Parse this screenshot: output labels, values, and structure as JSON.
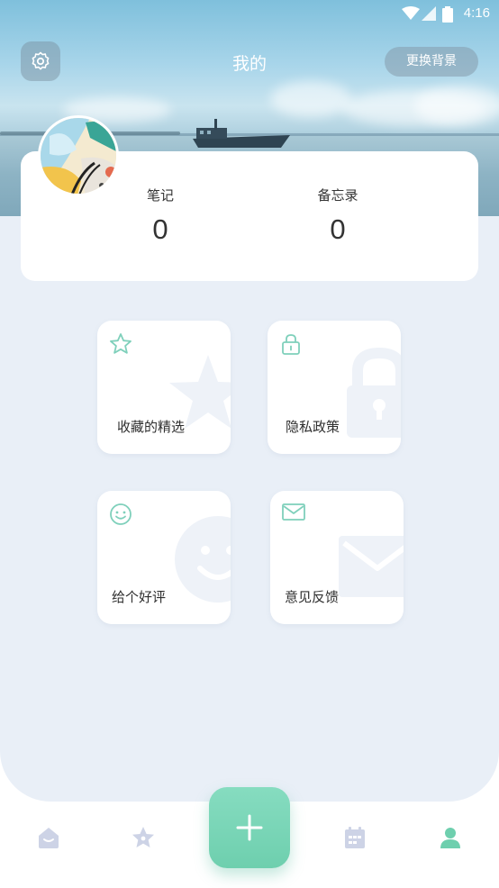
{
  "status_bar": {
    "time": "4:16"
  },
  "header": {
    "title": "我的",
    "change_bg_label": "更换背景"
  },
  "stats": [
    {
      "label": "笔记",
      "value": "0"
    },
    {
      "label": "备忘录",
      "value": "0"
    }
  ],
  "tiles": [
    {
      "label": "收藏的精选",
      "icon": "star-icon"
    },
    {
      "label": "隐私政策",
      "icon": "lock-icon"
    },
    {
      "label": "给个好评",
      "icon": "smile-icon"
    },
    {
      "label": "意见反馈",
      "icon": "mail-icon"
    }
  ],
  "bottom_nav": {
    "items": [
      {
        "icon": "home-icon",
        "active": false
      },
      {
        "icon": "star-icon",
        "active": false
      },
      {
        "icon": "plus-icon",
        "active": false
      },
      {
        "icon": "calendar-icon",
        "active": false
      },
      {
        "icon": "user-icon",
        "active": true
      }
    ]
  },
  "colors": {
    "accent": "#78d4b6",
    "tile_icon": "#7fd0bb",
    "content_bg": "#e9eff7",
    "nav_inactive": "#cdd3e6"
  }
}
